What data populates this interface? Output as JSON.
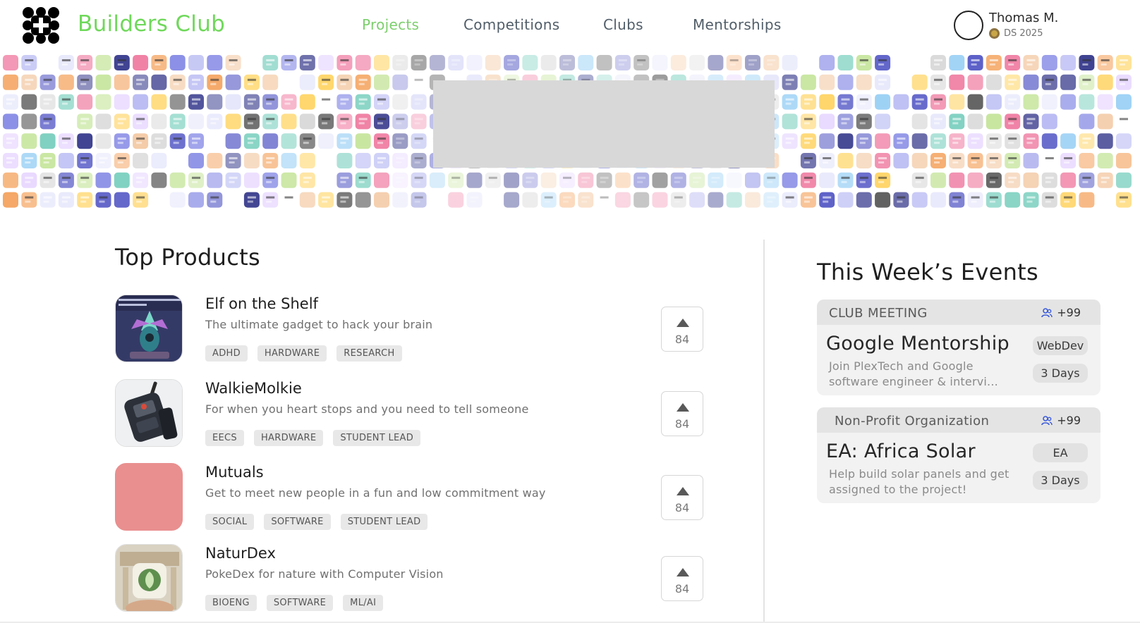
{
  "brand": {
    "name": "Builders Club",
    "logo_icon": "builders-club-logo-icon",
    "brand_color": "#6fd85a"
  },
  "nav": {
    "items": [
      {
        "label": "Projects",
        "active": true
      },
      {
        "label": "Competitions",
        "active": false
      },
      {
        "label": "Clubs",
        "active": false
      },
      {
        "label": "Mentorships",
        "active": false
      }
    ]
  },
  "user": {
    "name": "Thomas M.",
    "subtitle": "DS 2025",
    "badge_icon": "coin-icon"
  },
  "banner": {
    "description_icon": "app-icon-mosaic"
  },
  "products": {
    "title": "Top Products",
    "items": [
      {
        "name": "Elf on the Shelf",
        "description": "The ultimate gadget to hack your brain",
        "tags": [
          "ADHD",
          "HARDWARE",
          "RESEARCH"
        ],
        "votes": "84",
        "thumb_color": "#3b3f6a"
      },
      {
        "name": "WalkieMolkie",
        "description": "For when you heart stops and you need to tell someone",
        "tags": [
          "EECS",
          "HARDWARE",
          "STUDENT LEAD"
        ],
        "votes": "84",
        "thumb_color": "#2b3139"
      },
      {
        "name": "Mutuals",
        "description": "Get to meet new people in a fun and low commitment way",
        "tags": [
          "SOCIAL",
          "SOFTWARE",
          "STUDENT LEAD"
        ],
        "votes": "84",
        "thumb_color": "#e98f8f"
      },
      {
        "name": "NaturDex",
        "description": "PokeDex for nature with Computer Vision",
        "tags": [
          "BIOENG",
          "SOFTWARE",
          "ML/AI"
        ],
        "votes": "84",
        "thumb_color": "#b7c9a8"
      }
    ]
  },
  "events": {
    "title": "This Week’s Events",
    "items": [
      {
        "category": "CLUB MEETING",
        "count": "+99",
        "title": "Google Mentorship",
        "description": "Join PlexTech and Google software engineer & intervi...",
        "tag": "WebDev",
        "when": "3 Days"
      },
      {
        "category": "Non-Profit Organization",
        "count": "+99",
        "title": "EA: Africa Solar",
        "description": "Help build solar panels and get assigned to the project!",
        "tag": "EA",
        "when": "3 Days"
      }
    ]
  }
}
